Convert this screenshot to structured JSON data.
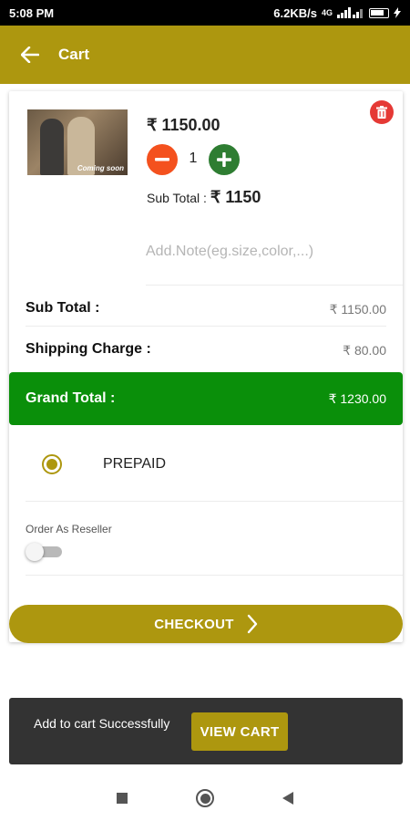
{
  "status_bar": {
    "time": "5:08 PM",
    "network_speed": "6.2KB/s",
    "network_type": "4G",
    "battery_icon": "battery-icon"
  },
  "app_bar": {
    "title": "Cart",
    "back_icon": "arrow-left-icon"
  },
  "cart_item": {
    "image_caption": "Coming soon",
    "price": "₹ 1150.00",
    "quantity": "1",
    "subtotal_label": "Sub Total :",
    "subtotal_value": "₹ 1150",
    "note_placeholder": "Add.Note(eg.size,color,...)",
    "delete_icon": "trash-icon",
    "minus_icon": "minus-icon",
    "plus_icon": "plus-icon"
  },
  "summary": {
    "subtotal_label": "Sub Total :",
    "subtotal_value": "₹ 1150.00",
    "shipping_label": "Shipping Charge :",
    "shipping_value": "₹ 80.00",
    "grand_total_label": "Grand Total :",
    "grand_total_value": "₹ 1230.00"
  },
  "payment": {
    "option_label": "PREPAID",
    "selected": true
  },
  "reseller": {
    "label": "Order As Reseller",
    "enabled": false
  },
  "checkout": {
    "label": "CHECKOUT",
    "icon": "chevron-right-icon"
  },
  "snackbar": {
    "message": "Add to cart Successfully",
    "action_label": "VIEW CART"
  },
  "nav": {
    "recents_icon": "square-icon",
    "home_icon": "circle-icon",
    "back_icon": "triangle-back-icon"
  },
  "colors": {
    "primary": "#ad970f",
    "grand_total": "#0a8f0a",
    "minus": "#f4511e",
    "plus": "#2e7d32",
    "delete": "#e53935",
    "snackbar": "#333333"
  }
}
